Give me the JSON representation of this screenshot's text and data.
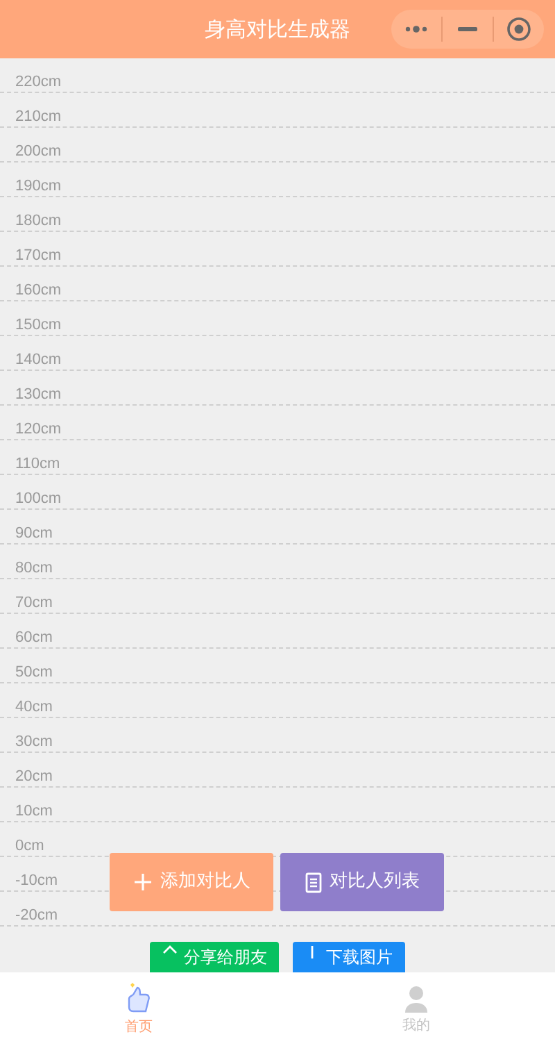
{
  "header": {
    "title": "身高对比生成器"
  },
  "ruler": {
    "marks": [
      "220cm",
      "210cm",
      "200cm",
      "190cm",
      "180cm",
      "170cm",
      "160cm",
      "150cm",
      "140cm",
      "130cm",
      "120cm",
      "110cm",
      "100cm",
      "90cm",
      "80cm",
      "70cm",
      "60cm",
      "50cm",
      "40cm",
      "30cm",
      "20cm",
      "10cm",
      "0cm",
      "-10cm",
      "-20cm"
    ]
  },
  "actions": [
    {
      "label": "添加对比人",
      "kind": "add"
    },
    {
      "label": "对比人列表",
      "kind": "list"
    }
  ],
  "share_actions": [
    {
      "label": "分享给朋友",
      "kind": "share"
    },
    {
      "label": "下载图片",
      "kind": "download"
    }
  ],
  "tab_bar": [
    {
      "label": "首页",
      "selected": true
    },
    {
      "label": "我的",
      "selected": false
    }
  ]
}
